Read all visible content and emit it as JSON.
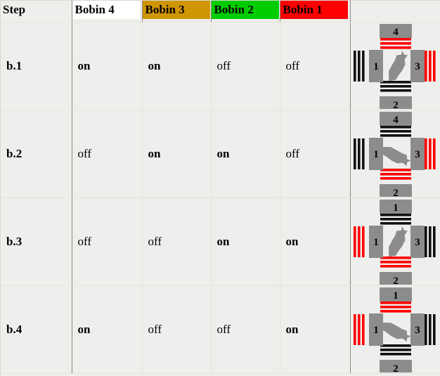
{
  "table": {
    "headers": [
      {
        "label": "Step",
        "bg": "transparent",
        "swatch": false
      },
      {
        "label": "Bobin 4",
        "bg": "#ffffff",
        "swatch": true
      },
      {
        "label": "Bobin 3",
        "bg": "#cf9503",
        "swatch": true
      },
      {
        "label": "Bobin 2",
        "bg": "#00cc00",
        "swatch": true
      },
      {
        "label": "Bobin 1",
        "bg": "#fe0000",
        "swatch": true
      },
      {
        "label": "",
        "bg": "transparent",
        "swatch": false
      }
    ],
    "rows": [
      {
        "step": "b.1",
        "bobin4": "on",
        "bobin3": "on",
        "bobin2": "off",
        "bobin1": "off",
        "diagram": {
          "top": {
            "label": "4",
            "state": "on",
            "stripes_side": "bottom"
          },
          "left": {
            "label": "1",
            "state": "off"
          },
          "right": {
            "label": "3",
            "state": "on"
          },
          "bottom": {
            "label": "2",
            "state": "off",
            "stripes_side": "top"
          },
          "arrow": "up-right"
        }
      },
      {
        "step": "b.2",
        "bobin4": "off",
        "bobin3": "on",
        "bobin2": "on",
        "bobin1": "off",
        "diagram": {
          "top": {
            "label": "4",
            "state": "off",
            "stripes_side": "bottom"
          },
          "left": {
            "label": "1",
            "state": "off"
          },
          "right": {
            "label": "3",
            "state": "on"
          },
          "bottom": {
            "label": "2",
            "state": "on",
            "stripes_side": "top"
          },
          "arrow": "down-right"
        }
      },
      {
        "step": "b.3",
        "bobin4": "off",
        "bobin3": "off",
        "bobin2": "on",
        "bobin1": "on",
        "diagram": {
          "top": {
            "label": "1",
            "state": "off",
            "stripes_side": "bottom"
          },
          "left": {
            "label": "1",
            "state": "on"
          },
          "right": {
            "label": "3",
            "state": "off"
          },
          "bottom": {
            "label": "2",
            "state": "on",
            "stripes_side": "top"
          },
          "arrow": "up-right"
        }
      },
      {
        "step": "b.4",
        "bobin4": "on",
        "bobin3": "off",
        "bobin2": "off",
        "bobin1": "on",
        "diagram": {
          "top": {
            "label": "1",
            "state": "on",
            "stripes_side": "bottom"
          },
          "left": {
            "label": "1",
            "state": "on"
          },
          "right": {
            "label": "3",
            "state": "off"
          },
          "bottom": {
            "label": "2",
            "state": "off",
            "stripes_side": "top"
          },
          "arrow": "down-right"
        }
      }
    ]
  },
  "colors": {
    "coil_on": "#fe0000",
    "coil_off": "#111111",
    "body_gray": "#8c8c8c",
    "rotor_gray": "#8c8c8c",
    "cell_bg": "#eeeeec",
    "hard_border": "#8a8a80",
    "soft_border": "#e6e4d8"
  }
}
